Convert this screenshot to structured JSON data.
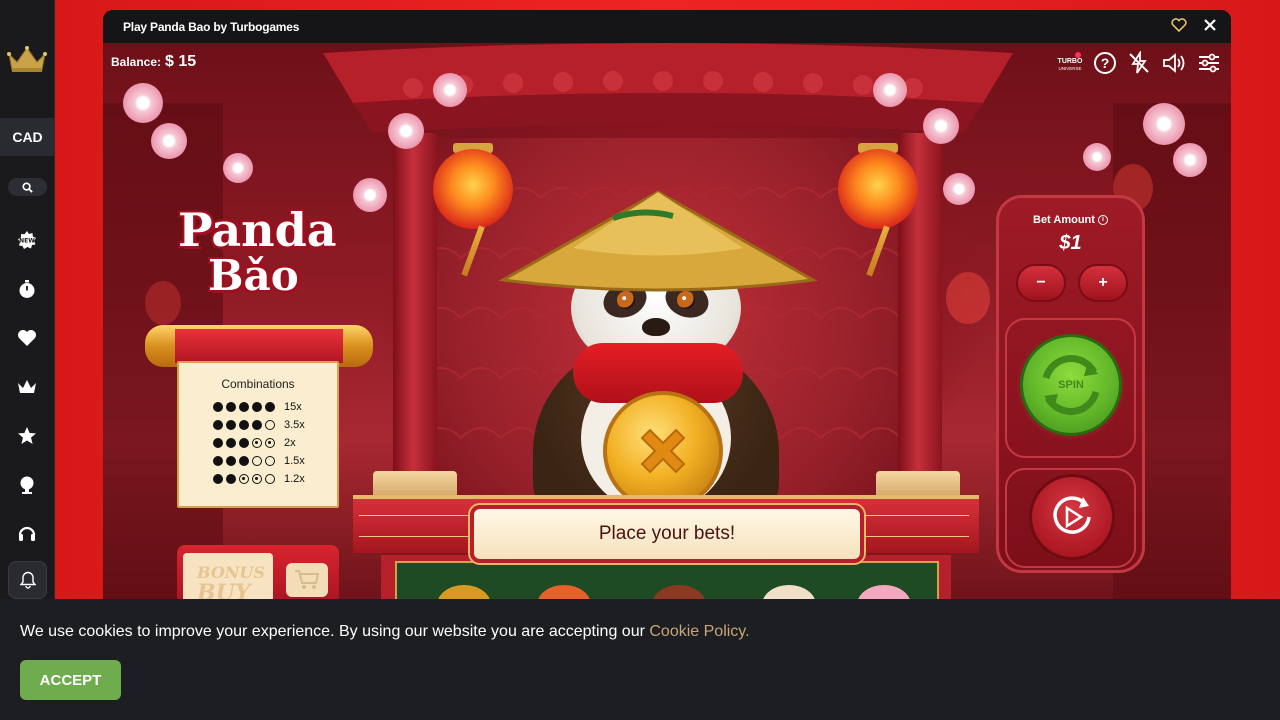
{
  "sidebar": {
    "currency": "CAD",
    "icons": [
      "crown-logo-icon",
      "search-icon",
      "new-badge-icon",
      "stopwatch-icon",
      "heart-icon",
      "crown-icon",
      "star-icon",
      "trophy-icon",
      "headset-icon",
      "bell-icon"
    ]
  },
  "game_window": {
    "title": "Play Panda Bao by Turbogames"
  },
  "game": {
    "balance_label": "Balance:",
    "balance_value": "$ 15",
    "logo_line1": "Panda",
    "logo_line2": "Bǎo",
    "combinations": {
      "title": "Combinations",
      "rows": [
        {
          "pattern": [
            "full",
            "full",
            "full",
            "full",
            "full"
          ],
          "multiplier": "15x"
        },
        {
          "pattern": [
            "full",
            "full",
            "full",
            "full",
            "empty"
          ],
          "multiplier": "3.5x"
        },
        {
          "pattern": [
            "full",
            "full",
            "full",
            "ring",
            "ring"
          ],
          "multiplier": "2x"
        },
        {
          "pattern": [
            "full",
            "full",
            "full",
            "empty",
            "empty"
          ],
          "multiplier": "1.5x"
        },
        {
          "pattern": [
            "full",
            "full",
            "ring",
            "ring",
            "empty"
          ],
          "multiplier": "1.2x"
        }
      ]
    },
    "bonus_buy_line1": "BONUS",
    "bonus_buy_line2": "BUY",
    "message": "Place your bets!",
    "bet": {
      "label": "Bet Amount",
      "value": "$1",
      "minus": "−",
      "plus": "+",
      "spin_label": "SPIN"
    },
    "turbo_logo_line1": "TURBO",
    "turbo_logo_line2": "UNIVERSE"
  },
  "colors": {
    "accent_red": "#e21e1e",
    "spin_green": "#62b72a",
    "accept_green": "#6fac4e",
    "cookie_link": "#c8a678"
  },
  "cookie_bar": {
    "text": "We use cookies to improve your experience. By using our website you are accepting our",
    "link": "Cookie Policy.",
    "accept_label": "ACCEPT"
  }
}
